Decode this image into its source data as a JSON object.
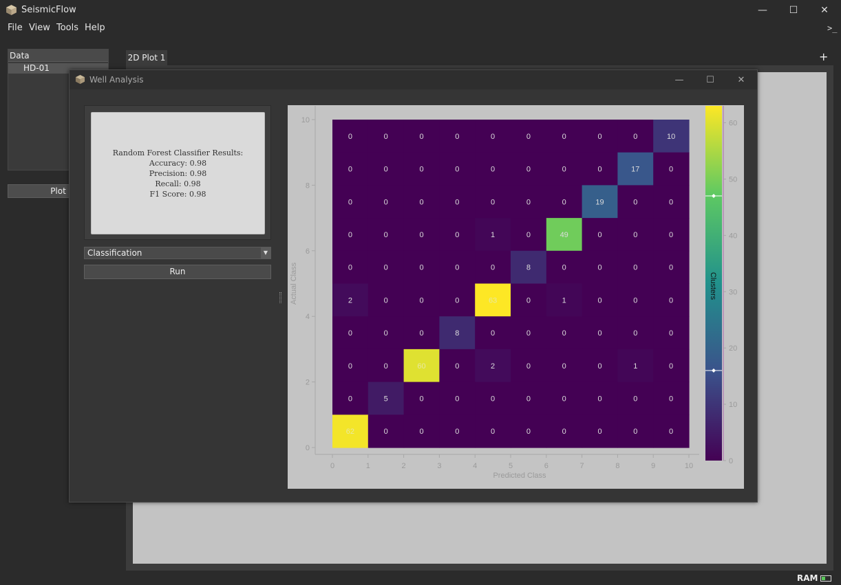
{
  "app": {
    "title": "SeismicFlow",
    "logo_icon": "cube-icon"
  },
  "window_controls": {
    "minimize": "—",
    "maximize": "☐",
    "close": "✕"
  },
  "menu": [
    "File",
    "View",
    "Tools",
    "Help"
  ],
  "terminal_icon": ">_",
  "data_panel": {
    "header": "Data",
    "items": [
      "HD-01"
    ]
  },
  "plot_button": "Plot",
  "tabs": {
    "active": "2D Plot 1",
    "add": "+"
  },
  "status": {
    "ram_label": "RAM",
    "ram_usage": 0.35,
    "ram_color": "#5ac85a"
  },
  "dialog": {
    "title": "Well Analysis",
    "results": {
      "heading": "Random Forest Classifier Results:",
      "lines": [
        "Accuracy: 0.98",
        "Precision: 0.98",
        "Recall: 0.98",
        "F1 Score: 0.98"
      ]
    },
    "mode_select": {
      "value": "Classification"
    },
    "run_button": "Run"
  },
  "chart_data": {
    "type": "heatmap",
    "xlabel": "Predicted Class",
    "ylabel": "Actual Class",
    "x_ticks": [
      0,
      1,
      2,
      3,
      4,
      5,
      6,
      7,
      8,
      9,
      10
    ],
    "y_ticks": [
      0,
      2,
      4,
      6,
      8,
      10
    ],
    "xlim": [
      0,
      10
    ],
    "ylim": [
      0,
      10
    ],
    "colorbar": {
      "label": "Clusters",
      "ticks": [
        0,
        10,
        20,
        30,
        40,
        50,
        60
      ],
      "range": [
        0,
        63
      ],
      "colormap": "viridis"
    },
    "matrix_rows_top_to_bottom": [
      [
        0,
        0,
        0,
        0,
        0,
        0,
        0,
        0,
        0,
        10
      ],
      [
        0,
        0,
        0,
        0,
        0,
        0,
        0,
        0,
        17,
        0
      ],
      [
        0,
        0,
        0,
        0,
        0,
        0,
        0,
        19,
        0,
        0
      ],
      [
        0,
        0,
        0,
        0,
        1,
        0,
        49,
        0,
        0,
        0
      ],
      [
        0,
        0,
        0,
        0,
        0,
        8,
        0,
        0,
        0,
        0
      ],
      [
        2,
        0,
        0,
        0,
        63,
        0,
        1,
        0,
        0,
        0
      ],
      [
        0,
        0,
        0,
        8,
        0,
        0,
        0,
        0,
        0,
        0
      ],
      [
        0,
        0,
        60,
        0,
        2,
        0,
        0,
        0,
        1,
        0
      ],
      [
        0,
        5,
        0,
        0,
        0,
        0,
        0,
        0,
        0,
        0
      ],
      [
        62,
        0,
        0,
        0,
        0,
        0,
        0,
        0,
        0,
        0
      ]
    ]
  }
}
